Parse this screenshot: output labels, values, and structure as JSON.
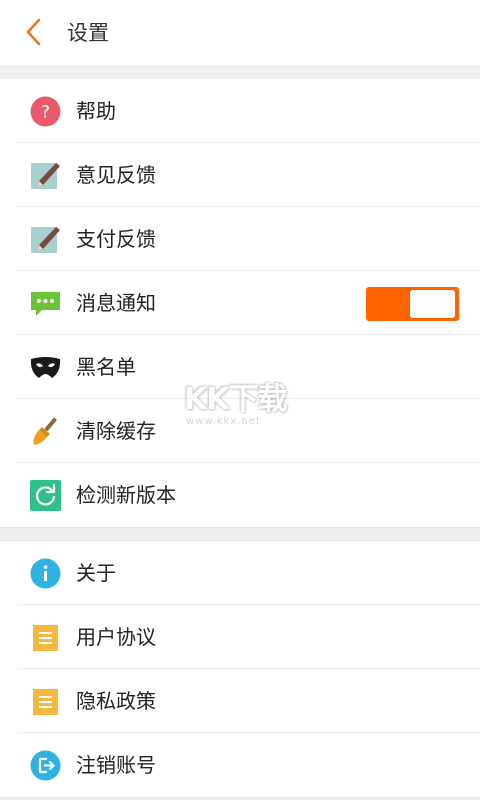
{
  "header": {
    "title": "设置",
    "back_icon": "chevron-left-icon",
    "accent": "#e87722"
  },
  "section1": [
    {
      "key": "help",
      "label": "帮助",
      "icon": "question-circle-icon"
    },
    {
      "key": "feedback",
      "label": "意见反馈",
      "icon": "pencil-note-icon"
    },
    {
      "key": "pay-feedback",
      "label": "支付反馈",
      "icon": "pencil-note-icon"
    },
    {
      "key": "notifications",
      "label": "消息通知",
      "icon": "chat-bubble-icon",
      "toggle_on": true
    },
    {
      "key": "blacklist",
      "label": "黑名单",
      "icon": "mask-icon"
    },
    {
      "key": "clear-cache",
      "label": "清除缓存",
      "icon": "broom-icon"
    },
    {
      "key": "check-update",
      "label": "检测新版本",
      "icon": "refresh-icon"
    }
  ],
  "section2": [
    {
      "key": "about",
      "label": "关于",
      "icon": "info-circle-icon"
    },
    {
      "key": "user-agreement",
      "label": "用户协议",
      "icon": "document-icon"
    },
    {
      "key": "privacy-policy",
      "label": "隐私政策",
      "icon": "document-icon"
    },
    {
      "key": "logout",
      "label": "注销账号",
      "icon": "logout-icon"
    }
  ],
  "watermark": {
    "logo": "KK下载",
    "url": "www.kkx.net"
  },
  "colors": {
    "toggle_on": "#ff6200",
    "help_icon": "#eb5a6a",
    "info_icon": "#2fb2e0",
    "green_icon": "#6cc33a",
    "teal_icon": "#2ec08a",
    "doc_icon": "#f4b93c"
  }
}
